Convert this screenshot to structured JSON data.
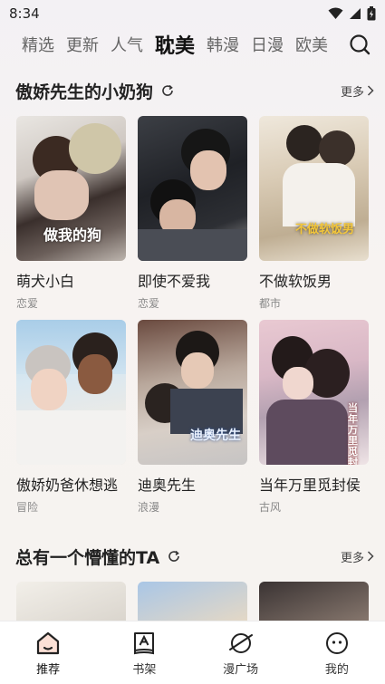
{
  "status": {
    "time": "8:34"
  },
  "tabs": [
    {
      "label": "精选"
    },
    {
      "label": "更新"
    },
    {
      "label": "人气"
    },
    {
      "label": "耽美"
    },
    {
      "label": "韩漫"
    },
    {
      "label": "日漫"
    },
    {
      "label": "欧美"
    }
  ],
  "section1": {
    "title": "傲娇先生的小奶狗",
    "more": "更多",
    "items": [
      {
        "title": "萌犬小白",
        "genre": "恋爱",
        "cover_text": "做我的狗"
      },
      {
        "title": "即使不爱我",
        "genre": "恋爱"
      },
      {
        "title": "不做软饭男",
        "genre": "都市",
        "cover_text": "不做软饭男"
      },
      {
        "title": "傲娇奶爸休想逃",
        "genre": "冒险"
      },
      {
        "title": "迪奥先生",
        "genre": "浪漫",
        "cover_text": "迪奥先生"
      },
      {
        "title": "当年万里觅封侯",
        "genre": "古风",
        "cover_text": "当年万里觅封侯"
      }
    ]
  },
  "section2": {
    "title": "总有一个懵懂的TA",
    "more": "更多"
  },
  "nav": [
    {
      "label": "推荐",
      "icon": "home-icon"
    },
    {
      "label": "书架",
      "icon": "bookshelf-icon"
    },
    {
      "label": "漫广场",
      "icon": "planet-icon"
    },
    {
      "label": "我的",
      "icon": "profile-icon"
    }
  ]
}
